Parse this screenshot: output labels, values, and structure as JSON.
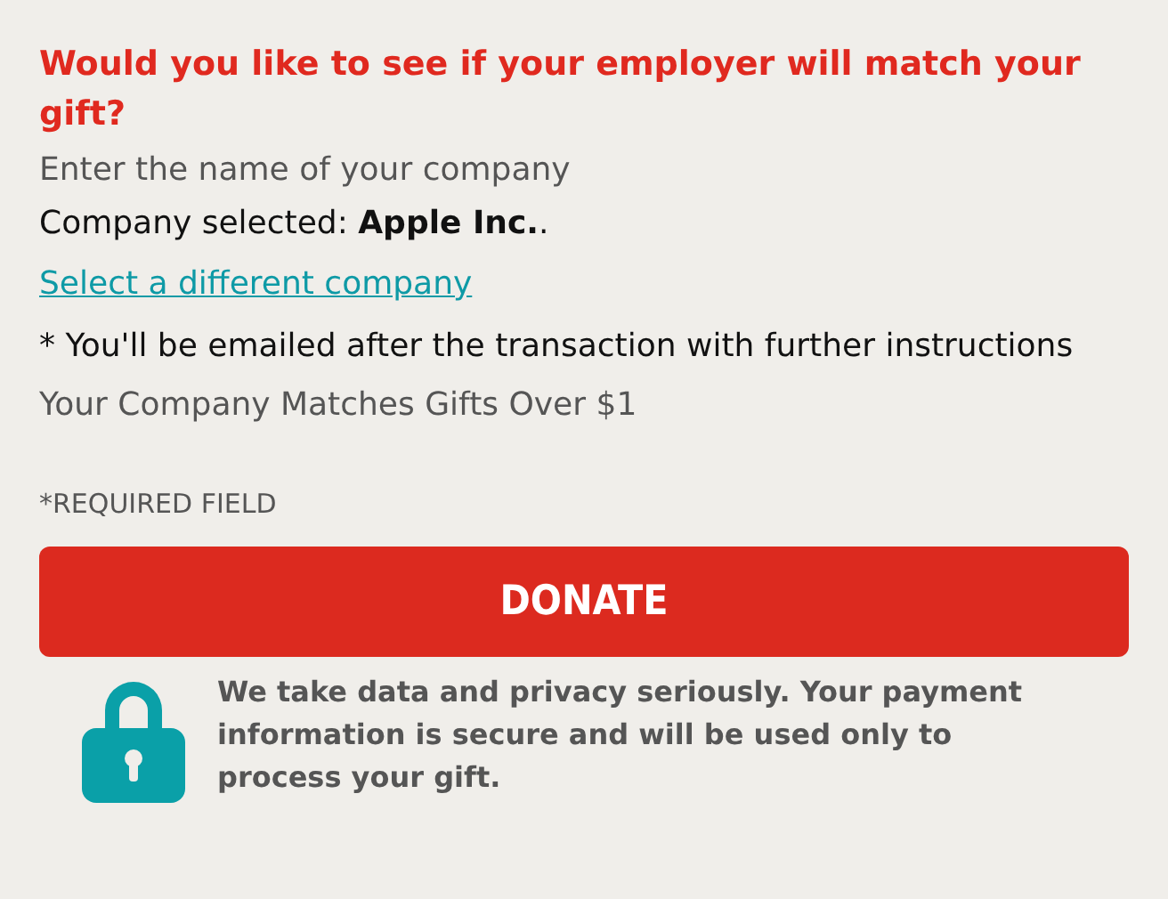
{
  "heading": "Would you like to see if your employer will match your gift?",
  "prompt": "Enter the name of your company",
  "company_selected": "Company selected: **Apple Inc.**.",
  "change_link": "Select a different company",
  "email_note": "* You'll be emailed after the transaction with further instructions",
  "match_info": "Your Company Matches Gifts Over $1",
  "required_note": "*REQUIRED FIELD",
  "donate_button": "DONATE",
  "privacy_note": "We take data and privacy seriously. Your payment information is secure and will be used only to process your gift."
}
